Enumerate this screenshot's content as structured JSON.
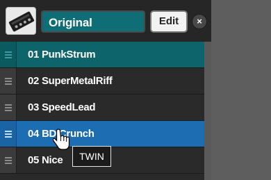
{
  "header": {
    "device_icon": "amp-device-icon",
    "preset_name": "Original",
    "edit_label": "Edit",
    "close_icon": "close-icon",
    "close_glyph": "×"
  },
  "presets": [
    {
      "label": "01  PunkStrum",
      "state": "highlighted"
    },
    {
      "label": "02  SuperMetalRiff",
      "state": "normal"
    },
    {
      "label": "03  SpeedLead",
      "state": "normal"
    },
    {
      "label": "04  BD Crunch",
      "state": "selected"
    },
    {
      "label": "05  Nice",
      "state": "normal"
    }
  ],
  "tooltip": {
    "text": "TWIN"
  },
  "cursor": {
    "icon": "hand-pointer-icon"
  },
  "colors": {
    "teal": "#0d646b",
    "selected_blue": "#1d6db3",
    "list_bg": "#2a2a2a",
    "right_area": "#5e5e5e"
  }
}
